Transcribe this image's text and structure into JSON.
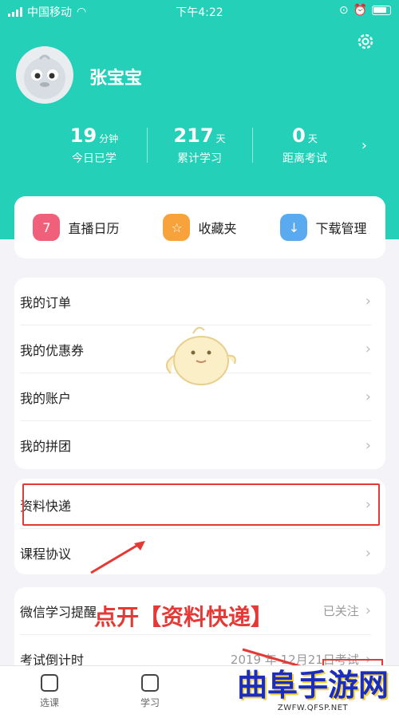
{
  "status_bar": {
    "carrier": "中国移动",
    "time": "下午4:22"
  },
  "profile": {
    "name": "张宝宝"
  },
  "stats": [
    {
      "value": "19",
      "unit": "分钟",
      "label": "今日已学"
    },
    {
      "value": "217",
      "unit": "天",
      "label": "累计学习"
    },
    {
      "value": "0",
      "unit": "天",
      "label": "距离考试"
    }
  ],
  "quick_actions": [
    {
      "label": "直播日历",
      "icon": "calendar-icon",
      "color": "#f0607a"
    },
    {
      "label": "收藏夹",
      "icon": "star-icon",
      "color": "#f7a23a"
    },
    {
      "label": "下载管理",
      "icon": "download-icon",
      "color": "#5aaaf0"
    }
  ],
  "menu1": [
    {
      "label": "我的订单"
    },
    {
      "label": "我的优惠券"
    },
    {
      "label": "我的账户"
    },
    {
      "label": "我的拼团"
    }
  ],
  "menu2": [
    {
      "label": "资料快递"
    },
    {
      "label": "课程协议"
    }
  ],
  "menu3": [
    {
      "label": "微信学习提醒",
      "right": "已关注"
    },
    {
      "label": "考试倒计时",
      "right": "2019 年 12月21日考试"
    }
  ],
  "annotation": {
    "text": "点开【资料快递】"
  },
  "tabs": [
    {
      "label": "选课"
    },
    {
      "label": "学习"
    }
  ],
  "watermark": {
    "title": "曲阜手游网",
    "url": "ZWFW.QFSP.NET"
  },
  "colors": {
    "header": "#24d0b8",
    "highlight": "#e53935"
  }
}
